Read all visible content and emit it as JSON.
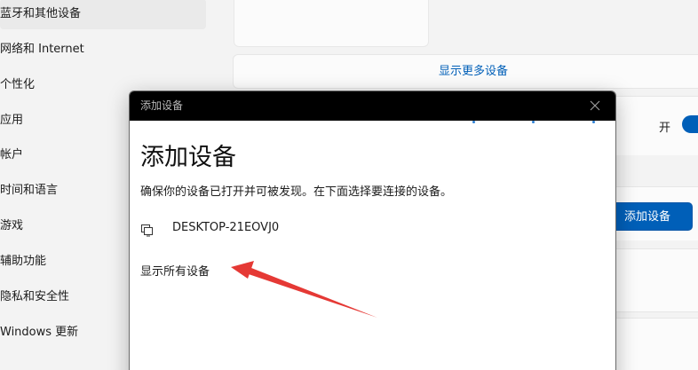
{
  "nav": {
    "items": [
      {
        "label": "蓝牙和其他设备"
      },
      {
        "label": "网络和 Internet"
      },
      {
        "label": "个性化"
      },
      {
        "label": "应用"
      },
      {
        "label": "帐户"
      },
      {
        "label": "时间和语言"
      },
      {
        "label": "游戏"
      },
      {
        "label": "辅助功能"
      },
      {
        "label": "隐私和安全性"
      },
      {
        "label": "Windows 更新"
      }
    ]
  },
  "main": {
    "show_more_label": "显示更多设备",
    "toggle_label": "开",
    "toggle_on": true,
    "add_device_button": "添加设备"
  },
  "dialog": {
    "title": "添加设备",
    "heading": "添加设备",
    "description": "确保你的设备已打开并可被发现。在下面选择要连接的设备。",
    "devices": [
      {
        "name": "DESKTOP-21EOVJ0",
        "icon": "computer-icon"
      }
    ],
    "show_all_label": "显示所有设备"
  },
  "colors": {
    "accent": "#005fb8",
    "annotation_arrow": "#e53935",
    "titlebar": "#000000"
  }
}
